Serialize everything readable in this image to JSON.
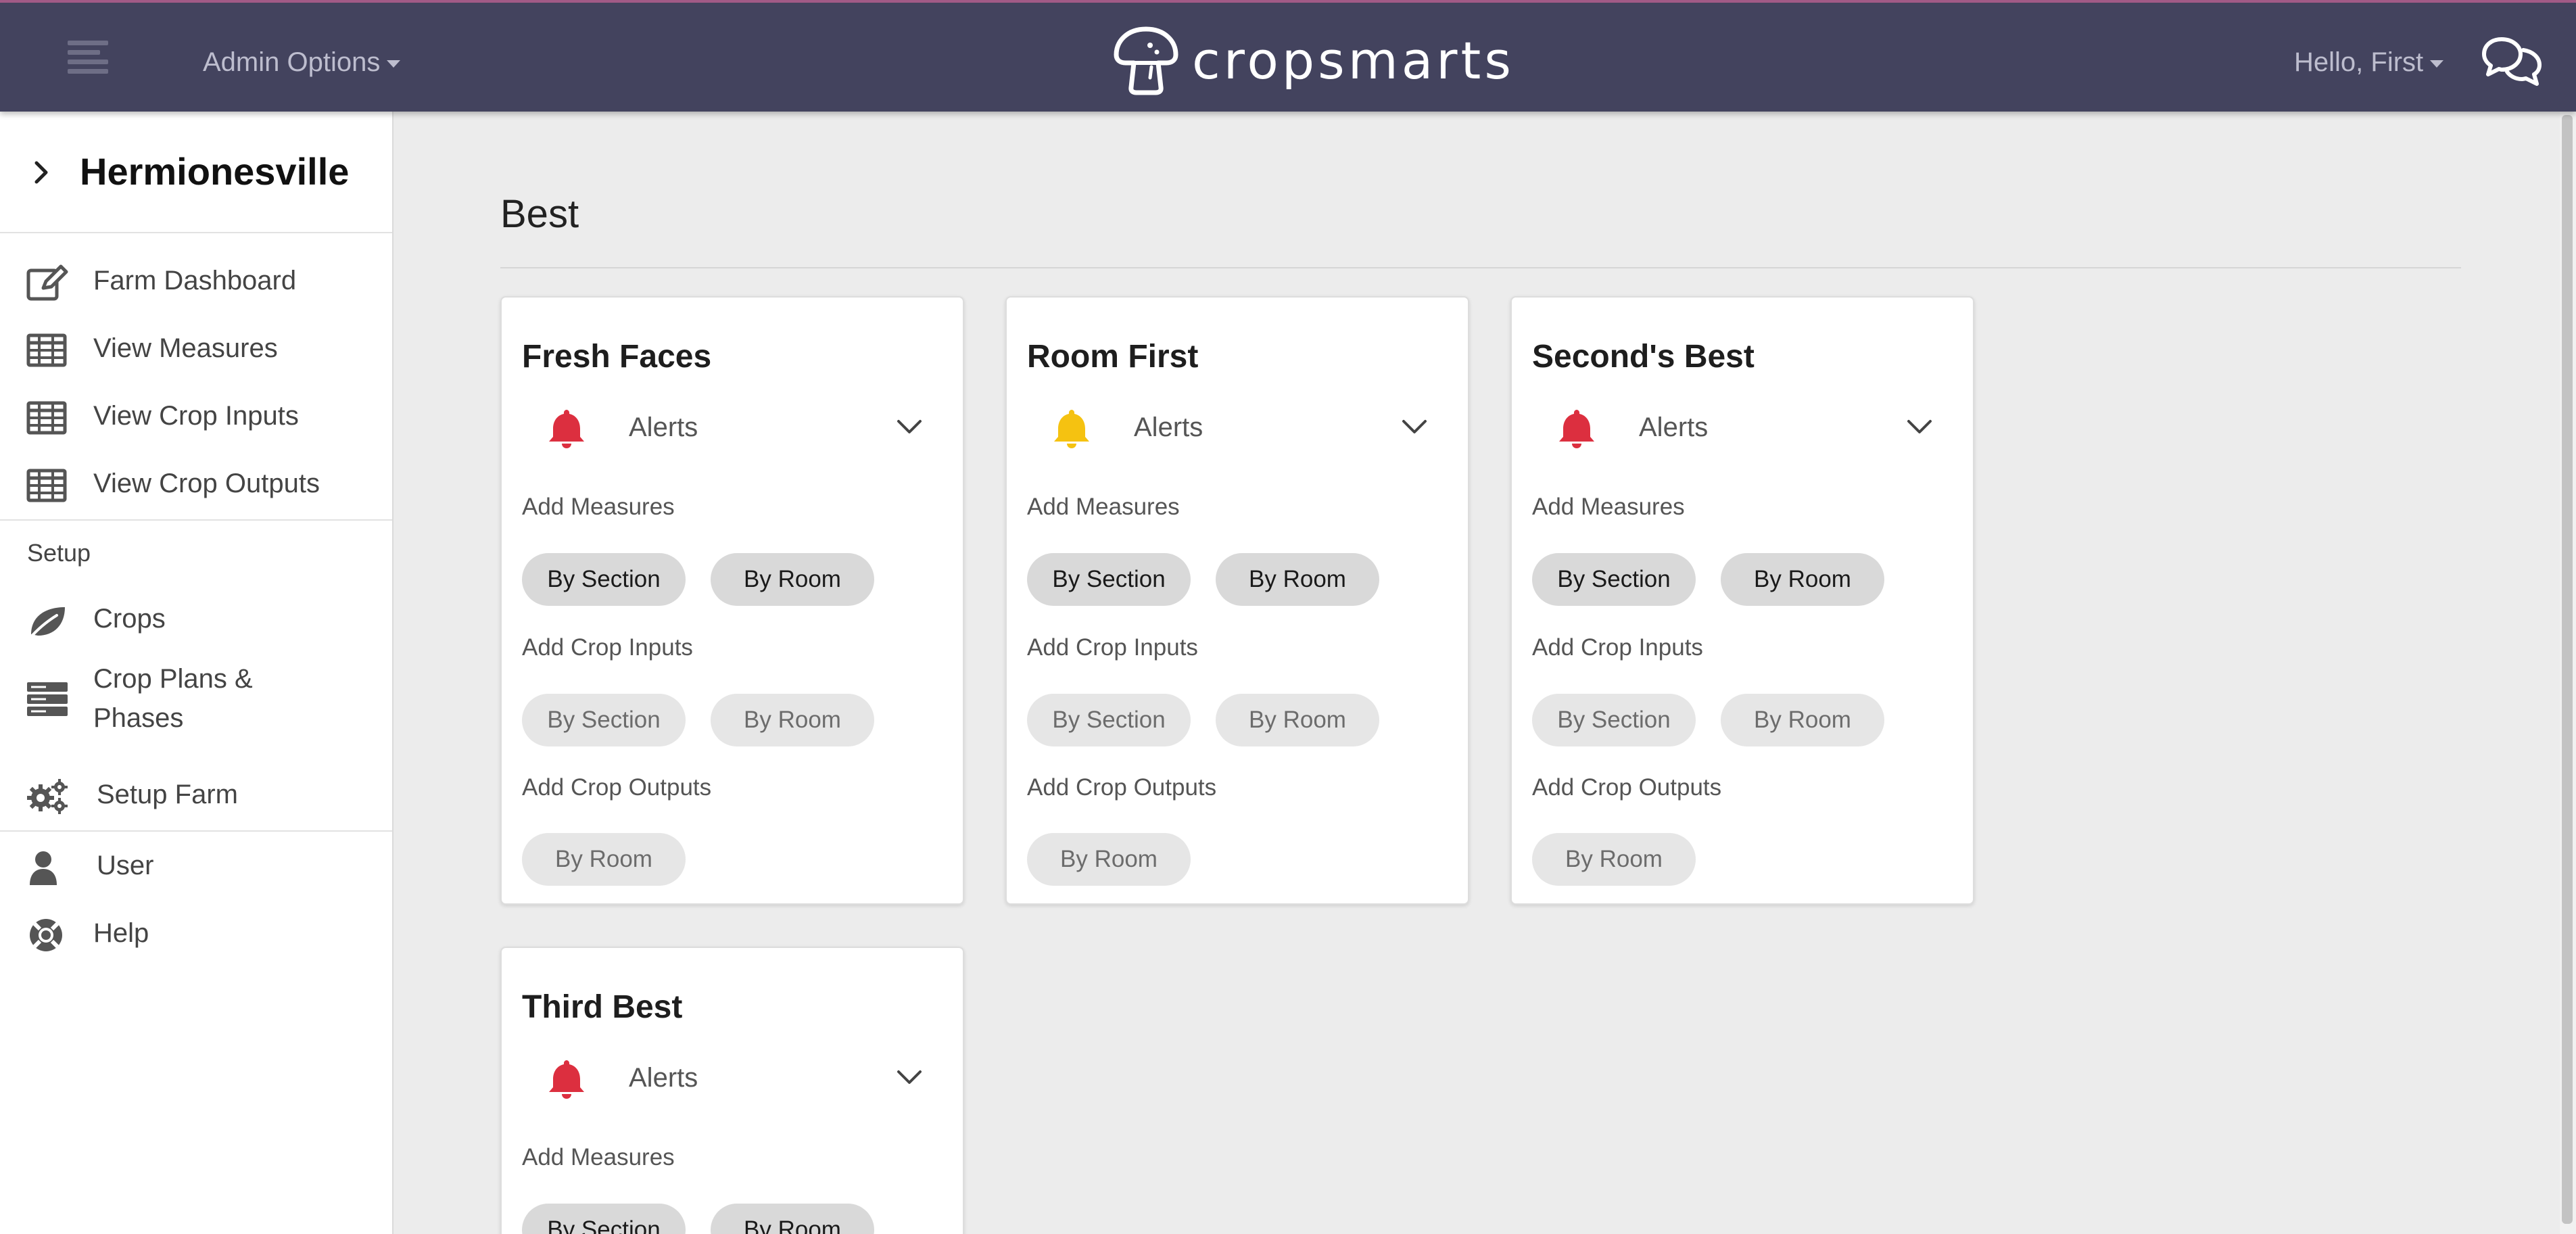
{
  "topbar": {
    "admin_options": "Admin Options",
    "brand": "cropsmarts",
    "greeting": "Hello, First",
    "colors": {
      "bar": "#43435e",
      "accent_line": "#a15a86",
      "muted_text": "#bdbdce"
    }
  },
  "sidebar": {
    "farm_name": "Hermionesville",
    "items": [
      {
        "label": "Farm Dashboard",
        "icon": "edit-icon"
      },
      {
        "label": "View Measures",
        "icon": "table-icon"
      },
      {
        "label": "View Crop Inputs",
        "icon": "table-icon"
      },
      {
        "label": "View Crop Outputs",
        "icon": "table-icon"
      }
    ],
    "setup_heading": "Setup",
    "setup_items": [
      {
        "label": "Crops",
        "icon": "leaf-icon"
      },
      {
        "label": "Crop Plans & Phases",
        "icon": "server-icon"
      },
      {
        "label": "Setup Farm",
        "icon": "cogs-icon"
      }
    ],
    "account_items": [
      {
        "label": "User",
        "icon": "user-icon"
      },
      {
        "label": "Help",
        "icon": "life-ring-icon"
      }
    ]
  },
  "main": {
    "title": "Best",
    "labels": {
      "alerts": "Alerts",
      "add_measures": "Add Measures",
      "add_crop_inputs": "Add Crop Inputs",
      "add_crop_outputs": "Add Crop Outputs",
      "by_section": "By Section",
      "by_room": "By Room"
    },
    "rooms": [
      {
        "name": "Fresh Faces",
        "alert_color": "#dc2f3f"
      },
      {
        "name": "Room First",
        "alert_color": "#f5c211"
      },
      {
        "name": "Second's Best",
        "alert_color": "#dc2f3f"
      },
      {
        "name": "Third Best",
        "alert_color": "#dc2f3f"
      }
    ]
  }
}
